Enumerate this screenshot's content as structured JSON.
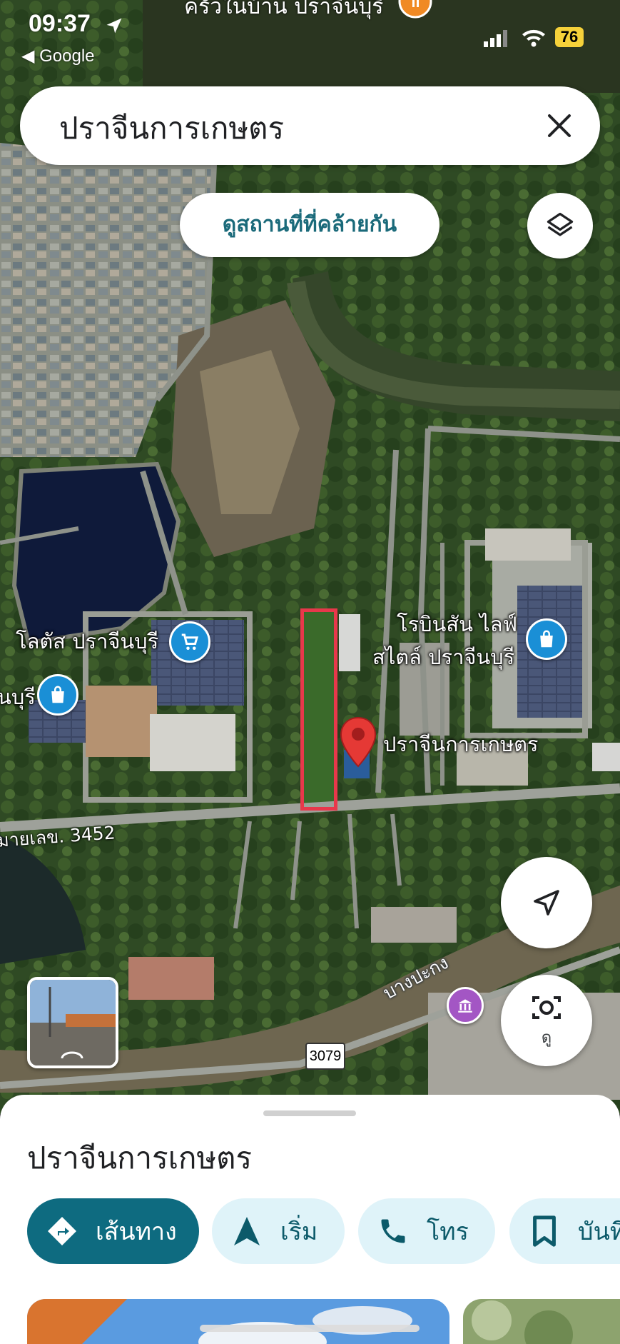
{
  "status_bar": {
    "time": "09:37",
    "back_app": "◀ Google",
    "battery": "76"
  },
  "map": {
    "top_partial_label": "ครัวในบ้าน ปราจีนบุรี",
    "labels": {
      "lotus": "โลตัส ปราจีนบุรี",
      "robinson_line1": "โรบินสัน ไลฟ์",
      "robinson_line2": "สไตล์ ปราจีนบุรี",
      "partial_left": "นบุรี",
      "selected_place": "ปราจีนการเกษตร",
      "road": "มายเลข. 3452",
      "river": "บางปะกง",
      "road_shield": "3079"
    },
    "icons": {
      "lotus_poi": "shopping-cart-icon",
      "robinson_poi": "shopping-bag-icon",
      "left_poi": "shopping-bag-icon",
      "museum_poi": "museum-icon",
      "pin": "red-location-pin-icon"
    },
    "colors": {
      "highlight": "#e8384b",
      "poi_blue": "#1a8fd6",
      "museum": "#a356c4",
      "pin": "#e53935"
    }
  },
  "search": {
    "query": "ปราจีนการเกษตร"
  },
  "buttons": {
    "similar_places": "ดูสถานที่ที่คล้ายกัน",
    "lens_label": "ดู"
  },
  "sheet": {
    "title": "ปราจีนการเกษตร",
    "chips": [
      {
        "label": "เส้นทาง",
        "icon": "directions-icon"
      },
      {
        "label": "เริ่ม",
        "icon": "navigation-arrow-icon"
      },
      {
        "label": "โทร",
        "icon": "phone-icon"
      },
      {
        "label": "บันทึ",
        "icon": "bookmark-icon"
      }
    ],
    "accent": "#0e6b80"
  }
}
